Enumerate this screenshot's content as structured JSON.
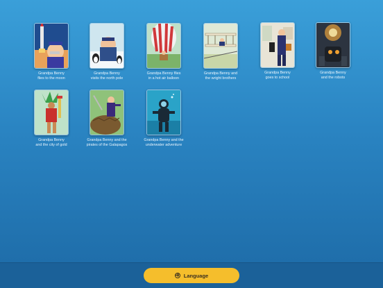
{
  "books": [
    {
      "line1": "Grandpa Benny",
      "line2": "flies to the moon",
      "cover": "rocket-launch"
    },
    {
      "line1": "Grandpa Benny",
      "line2": "visits the north pole",
      "cover": "snowy-penguins"
    },
    {
      "line1": "Grandpa Benny flies",
      "line2": "in a hot air balloon",
      "cover": "hot-air-balloon"
    },
    {
      "line1": "Grandpa Benny and",
      "line2": "the wright brothers",
      "cover": "biplane"
    },
    {
      "line1": "Grandpa Benny",
      "line2": "goes to school",
      "cover": "school"
    },
    {
      "line1": "Grandpa Benny",
      "line2": "and the robots",
      "cover": "robots"
    },
    {
      "line1": "Grandpa Benny",
      "line2": "and the city of gold",
      "cover": "aztec-warrior"
    },
    {
      "line1": "Grandpa Benny and the",
      "line2": "pirates of the Galapagos",
      "cover": "tortoise-pirates"
    },
    {
      "line1": "Grandpa Benny and the",
      "line2": "underwater adventure",
      "cover": "scuba-diver"
    }
  ],
  "footer": {
    "language_label": "Language",
    "language_icon": "globe-icon"
  },
  "colors": {
    "background_top": "#3a9fd9",
    "background_bottom": "#1d6aa6",
    "footer": "#1b6199",
    "button": "#f5be2c"
  }
}
